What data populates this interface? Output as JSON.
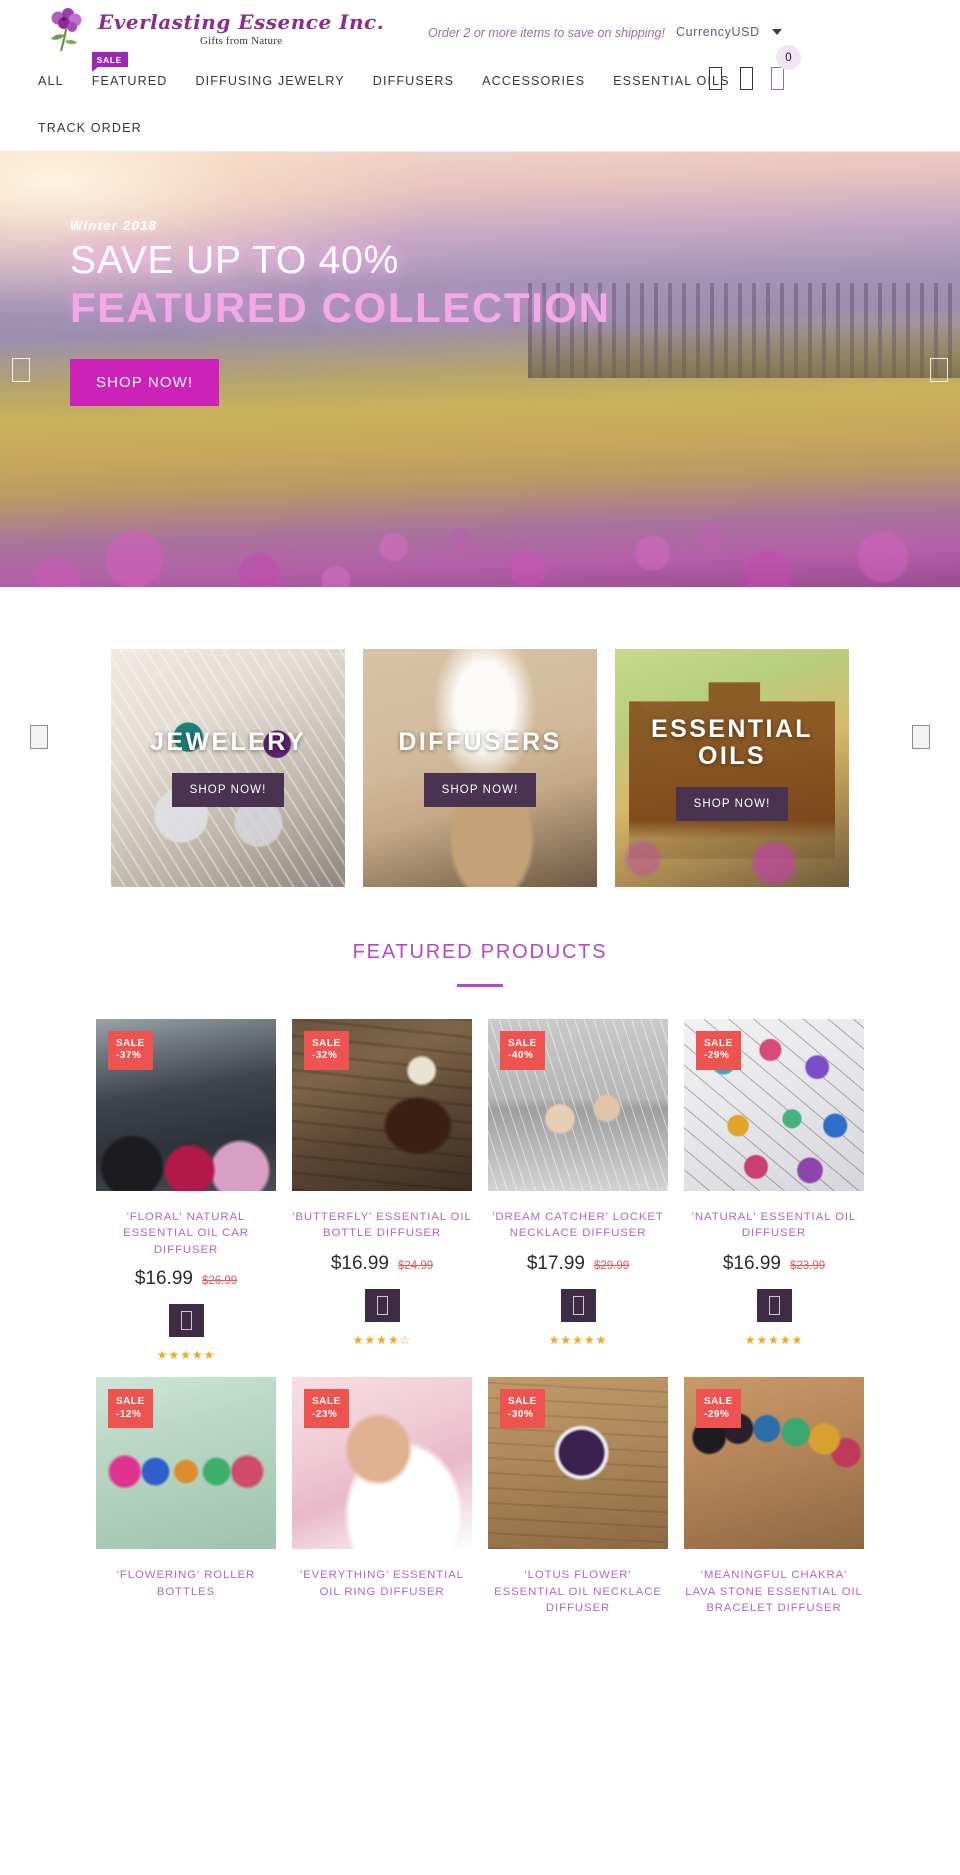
{
  "header": {
    "logo_name": "Everlasting Essence Inc.",
    "logo_tagline": "Gifts from Nature",
    "promo_message": "Order 2 or more items to save on shipping!",
    "currency_label": "Currency",
    "currency_value": "USD",
    "cart_count": "0",
    "icons": [
      "search-icon",
      "account-icon",
      "cart-icon"
    ]
  },
  "nav": {
    "items": [
      {
        "label": "ALL",
        "badge": null
      },
      {
        "label": "FEATURED",
        "badge": "SALE"
      },
      {
        "label": "DIFFUSING JEWELRY",
        "badge": null
      },
      {
        "label": "DIFFUSERS",
        "badge": null
      },
      {
        "label": "ACCESSORIES",
        "badge": null
      },
      {
        "label": "ESSENTIAL OILS",
        "badge": null
      }
    ],
    "second_row": [
      {
        "label": "TRACK ORDER"
      }
    ]
  },
  "hero": {
    "eyebrow": "Winter 2018",
    "headline": "SAVE UP TO 40%",
    "subheadline": "FEATURED COLLECTION",
    "button": "SHOP NOW!",
    "prev_label": "❮",
    "next_label": "❯"
  },
  "categories": {
    "prev_label": "❮",
    "next_label": "❯",
    "cards": [
      {
        "title": "JEWELERY",
        "button": "SHOP NOW!"
      },
      {
        "title": "DIFFUSERS",
        "button": "SHOP NOW!"
      },
      {
        "title": "ESSENTIAL OILS",
        "button": "SHOP NOW!"
      }
    ]
  },
  "featured": {
    "section_title": "FEATURED PRODUCTS",
    "products": [
      {
        "name": "'FLORAL' NATURAL ESSENTIAL OIL CAR DIFFUSER",
        "sale_label": "SALE",
        "sale_pct": "-37%",
        "price": "$16.99",
        "compare_price": "$26.99",
        "rating": 5,
        "rating_display": "★★★★★"
      },
      {
        "name": "'BUTTERFLY' ESSENTIAL OIL BOTTLE  DIFFUSER",
        "sale_label": "SALE",
        "sale_pct": "-32%",
        "price": "$16.99",
        "compare_price": "$24.99",
        "rating": 4.5,
        "rating_display": "★★★★☆"
      },
      {
        "name": "'DREAM CATCHER' LOCKET NECKLACE DIFFUSER",
        "sale_label": "SALE",
        "sale_pct": "-40%",
        "price": "$17.99",
        "compare_price": "$29.99",
        "rating": 5,
        "rating_display": "★★★★★"
      },
      {
        "name": "'NATURAL' ESSENTIAL OIL DIFFUSER",
        "sale_label": "SALE",
        "sale_pct": "-29%",
        "price": "$16.99",
        "compare_price": "$23.99",
        "rating": 5,
        "rating_display": "★★★★★"
      },
      {
        "name": "'FLOWERING' ROLLER BOTTLES",
        "sale_label": "SALE",
        "sale_pct": "-12%",
        "price": "",
        "compare_price": "",
        "rating": 0,
        "rating_display": ""
      },
      {
        "name": "'EVERYTHING' ESSENTIAL OIL RING DIFFUSER",
        "sale_label": "SALE",
        "sale_pct": "-23%",
        "price": "",
        "compare_price": "",
        "rating": 0,
        "rating_display": ""
      },
      {
        "name": "'LOTUS FLOWER' ESSENTIAL OIL NECKLACE DIFFUSER",
        "sale_label": "SALE",
        "sale_pct": "-30%",
        "price": "",
        "compare_price": "",
        "rating": 0,
        "rating_display": ""
      },
      {
        "name": "'MEANINGFUL CHAKRA' LAVA STONE ESSENTIAL OIL BRACELET DIFFUSER",
        "sale_label": "SALE",
        "sale_pct": "-29%",
        "price": "",
        "compare_price": "",
        "rating": 0,
        "rating_display": ""
      }
    ]
  },
  "colors": {
    "brand_purple": "#8e2b8e",
    "accent_pink": "#b048c8",
    "hero_button": "#cc22b8",
    "sale_red": "#ef5350",
    "dark_plum": "#4a3350"
  }
}
